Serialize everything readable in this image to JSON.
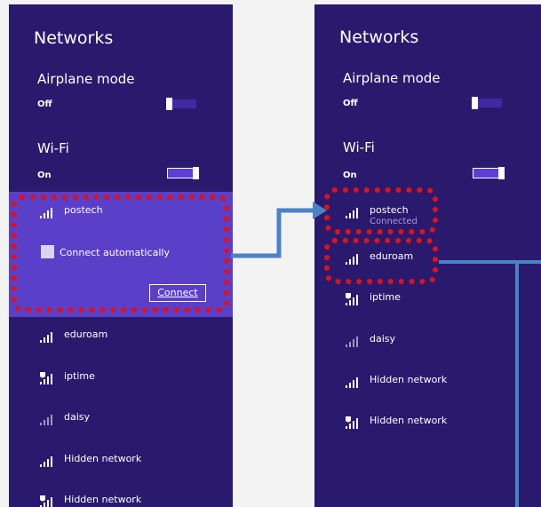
{
  "left_panel": {
    "title": "Networks",
    "airplane_label": "Airplane mode",
    "airplane_state": "Off",
    "wifi_label": "Wi-Fi",
    "wifi_state": "On",
    "selected_network": {
      "name": "postech",
      "auto_label": "Connect automatically",
      "connect_label": "Connect"
    },
    "networks": [
      {
        "name": "eduroam",
        "icon": "wifi-signal-icon"
      },
      {
        "name": "iptime",
        "icon": "wifi-secured-icon"
      },
      {
        "name": "daisy",
        "icon": "wifi-signal-icon"
      },
      {
        "name": "Hidden network",
        "icon": "wifi-signal-icon"
      },
      {
        "name": "Hidden network",
        "icon": "wifi-secured-icon"
      }
    ]
  },
  "right_panel": {
    "title": "Networks",
    "airplane_label": "Airplane mode",
    "airplane_state": "Off",
    "wifi_label": "Wi-Fi",
    "wifi_state": "On",
    "networks": [
      {
        "name": "postech",
        "status": "Connected",
        "icon": "wifi-signal-icon"
      },
      {
        "name": "eduroam",
        "icon": "wifi-signal-icon"
      },
      {
        "name": "iptime",
        "icon": "wifi-secured-icon"
      },
      {
        "name": "daisy",
        "icon": "wifi-signal-icon"
      },
      {
        "name": "Hidden network",
        "icon": "wifi-signal-icon"
      },
      {
        "name": "Hidden network",
        "icon": "wifi-secured-icon"
      }
    ]
  },
  "colors": {
    "panel_bg": "#2a1a6e",
    "selected_bg": "#5a3fc8",
    "highlight": "#e3101a",
    "arrow": "#4a82c8"
  }
}
